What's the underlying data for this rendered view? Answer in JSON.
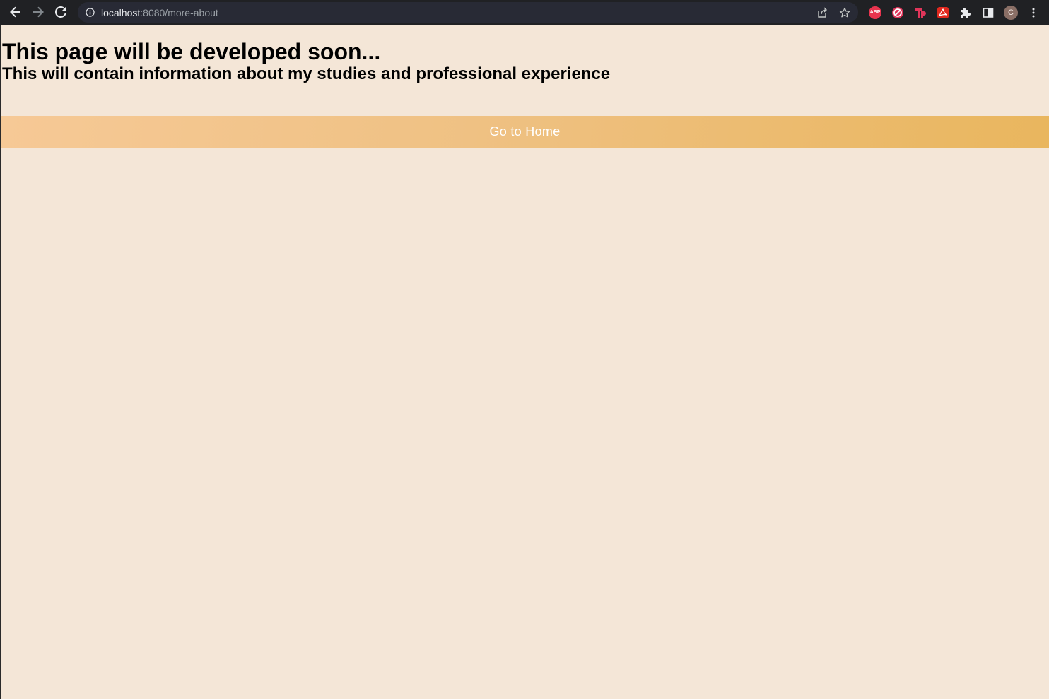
{
  "browser": {
    "url_host": "localhost",
    "url_rest": ":8080/more-about",
    "profile_initial": "C",
    "abp_label": "ABP",
    "extensions": [
      "adblock-plus-icon",
      "no-circle-icon",
      "tp-icon",
      "acrobat-icon",
      "puzzle-icon",
      "side-panel-icon"
    ]
  },
  "main": {
    "title": "This page will be developed soon...",
    "subtitle": "This will contain information about my studies and professional experience",
    "home_button_label": "Go to Home"
  },
  "colors": {
    "page_bg": "#f4e6d7",
    "button_gradient_start": "#f6c996",
    "button_gradient_end": "#e9b65e",
    "browser_bar": "#202124"
  }
}
